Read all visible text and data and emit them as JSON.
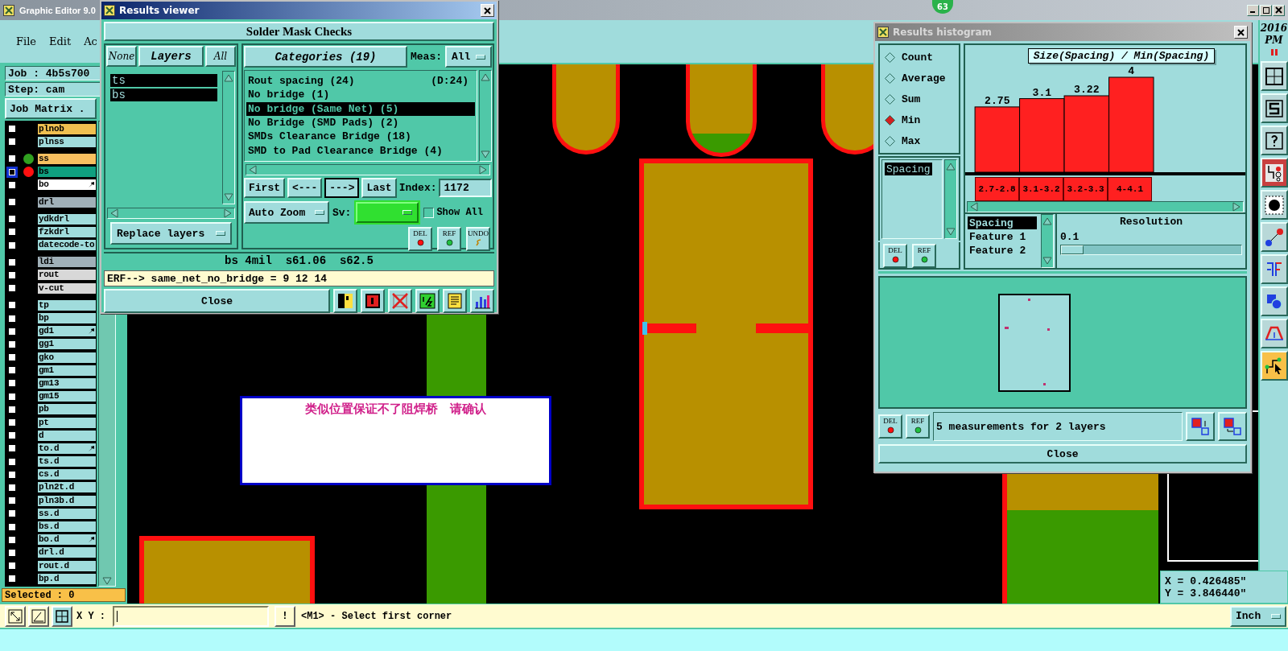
{
  "main_window": {
    "title": "Graphic Editor 9.0",
    "badge": "63"
  },
  "menu": [
    {
      "label": "File"
    },
    {
      "label": "Edit"
    },
    {
      "label": "Ac"
    }
  ],
  "job": "Job : 4b5s700",
  "step": "Step: cam",
  "job_matrix_button": "Job Matrix .",
  "layer_groups": [
    {
      "layers": [
        {
          "name": "plnob",
          "color": "#f0c050",
          "active": false,
          "flag": false
        },
        {
          "name": "plnss",
          "color": "#a0dcdc",
          "active": false,
          "flag": false
        }
      ]
    },
    {
      "layers": [
        {
          "name": "ss",
          "color": "#f8c060",
          "status": {
            "color": "#30a020"
          },
          "active": false,
          "flag": false
        },
        {
          "name": "bs",
          "color": "#10a080",
          "status": {
            "color": "#ff1010"
          },
          "active": true,
          "flag": false
        },
        {
          "name": "bo",
          "color": "#ffffff",
          "active": false,
          "flag": true
        }
      ]
    },
    {
      "layers": [
        {
          "name": "drl",
          "color": "#a0b0b8",
          "active": false,
          "flag": false
        }
      ]
    },
    {
      "layers": [
        {
          "name": "ydkdrl",
          "color": "#a0dcdc",
          "active": false,
          "flag": false
        },
        {
          "name": "fzkdrl",
          "color": "#a0dcdc",
          "active": false,
          "flag": false
        },
        {
          "name": "datecode-to",
          "color": "#a0dcdc",
          "active": false,
          "flag": false
        }
      ]
    },
    {
      "layers": [
        {
          "name": "ldi",
          "color": "#a0b0b8",
          "active": false,
          "flag": false
        },
        {
          "name": "rout",
          "color": "#d8d8d8",
          "active": false,
          "flag": false
        },
        {
          "name": "v-cut",
          "color": "#d8d8d8",
          "active": false,
          "flag": false
        }
      ]
    },
    {
      "layers": [
        {
          "name": "tp",
          "color": "#a0dcdc",
          "active": false,
          "flag": false
        },
        {
          "name": "bp",
          "color": "#a0dcdc",
          "active": false,
          "flag": false
        },
        {
          "name": "gd1",
          "color": "#a0dcdc",
          "active": false,
          "flag": true
        },
        {
          "name": "gg1",
          "color": "#a0dcdc",
          "active": false,
          "flag": false
        },
        {
          "name": "gko",
          "color": "#a0dcdc",
          "active": false,
          "flag": false
        },
        {
          "name": "gm1",
          "color": "#a0dcdc",
          "active": false,
          "flag": false
        },
        {
          "name": "gm13",
          "color": "#a0dcdc",
          "active": false,
          "flag": false
        },
        {
          "name": "gm15",
          "color": "#a0dcdc",
          "active": false,
          "flag": false
        },
        {
          "name": "pb",
          "color": "#a0dcdc",
          "active": false,
          "flag": false
        },
        {
          "name": "pt",
          "color": "#a0dcdc",
          "active": false,
          "flag": false
        },
        {
          "name": "d",
          "color": "#a0dcdc",
          "active": false,
          "flag": false
        },
        {
          "name": "to.d",
          "color": "#a0dcdc",
          "active": false,
          "flag": true
        },
        {
          "name": "ts.d",
          "color": "#a0dcdc",
          "active": false,
          "flag": false
        },
        {
          "name": "cs.d",
          "color": "#a0dcdc",
          "active": false,
          "flag": false
        },
        {
          "name": "pln2t.d",
          "color": "#a0dcdc",
          "active": false,
          "flag": false
        },
        {
          "name": "pln3b.d",
          "color": "#a0dcdc",
          "active": false,
          "flag": false
        },
        {
          "name": "ss.d",
          "color": "#a0dcdc",
          "active": false,
          "flag": false
        },
        {
          "name": "bs.d",
          "color": "#a0dcdc",
          "active": false,
          "flag": false
        },
        {
          "name": "bo.d",
          "color": "#a0dcdc",
          "active": false,
          "flag": true
        },
        {
          "name": "drl.d",
          "color": "#a0dcdc",
          "active": false,
          "flag": false
        },
        {
          "name": "rout.d",
          "color": "#a0dcdc",
          "active": false,
          "flag": false
        },
        {
          "name": "bp.d",
          "color": "#a0dcdc",
          "active": false,
          "flag": false
        }
      ]
    }
  ],
  "selected_count": "Selected : 0",
  "results_viewer": {
    "title": "Results viewer",
    "heading": "Solder Mask Checks",
    "layer_buttons": [
      {
        "label": "None",
        "kind": "plain"
      },
      {
        "label": "Layers",
        "kind": "title"
      },
      {
        "label": "All",
        "kind": "plain"
      }
    ],
    "layers": [
      {
        "name": "ts",
        "selected": true
      },
      {
        "name": "bs",
        "selected": true
      }
    ],
    "replace_dropdown": "Replace layers",
    "categories_button": "Categories (19)",
    "meas_label": "Meas:",
    "meas_value": "All",
    "categories": [
      {
        "label": "Rout spacing (24)",
        "note": "(D:24)",
        "selected": false
      },
      {
        "label": "No bridge (1)",
        "selected": false
      },
      {
        "label": "No bridge (Same Net) (5)",
        "selected": true
      },
      {
        "label": "No Bridge (SMD Pads) (2)",
        "selected": false
      },
      {
        "label": "SMDs Clearance Bridge (18)",
        "selected": false
      },
      {
        "label": "SMD to Pad Clearance Bridge (4)",
        "selected": false
      }
    ],
    "nav": [
      {
        "label": "First",
        "pressed": false
      },
      {
        "label": "<---",
        "pressed": false
      },
      {
        "label": "--->",
        "pressed": true
      },
      {
        "label": "Last",
        "pressed": false
      }
    ],
    "index_label": "Index:",
    "index_value": "1172",
    "zoom_dropdown": "Auto Zoom",
    "sv_label": "Sv:",
    "show_all": {
      "label": "Show All",
      "checked": false
    },
    "action_buttons": [
      "DEL",
      "REF",
      "UNDO"
    ],
    "status": "bs 4mil  s61.06  s62.5",
    "erf": "ERF--> same_net_no_bridge = 9 12 14",
    "close": "Close"
  },
  "histogram": {
    "title": "Results histogram",
    "modes": [
      {
        "label": "Count",
        "selected": false
      },
      {
        "label": "Average",
        "selected": false
      },
      {
        "label": "Sum",
        "selected": false
      },
      {
        "label": "Min",
        "selected": true
      },
      {
        "label": "Max",
        "selected": false
      }
    ],
    "fields": [
      {
        "label": "Spacing",
        "selected": true
      }
    ],
    "list_buttons": [
      "DEL",
      "REF"
    ],
    "chart_data": {
      "type": "bar",
      "title": "Size(Spacing) / Min(Spacing)",
      "categories": [
        "2.7-2.8",
        "3.1-3.2",
        "3.2-3.3",
        "4-4.1"
      ],
      "values": [
        2.75,
        3.1,
        3.22,
        4
      ],
      "data_labels": true
    },
    "value_labels": [
      "2.75",
      "3.1",
      "3.22",
      "4"
    ],
    "columns": [
      {
        "label": "Spacing",
        "selected": true
      },
      {
        "label": "Feature 1",
        "selected": false
      },
      {
        "label": "Feature 2",
        "selected": false
      }
    ],
    "resolution": {
      "label": "Resolution",
      "value": "0.1",
      "level": 0
    },
    "footer_buttons": [
      "DEL",
      "REF"
    ],
    "summary": "5 measurements for 2 layers",
    "close": "Close"
  },
  "clock": {
    "year": "2016",
    "period": "PM"
  },
  "tools": [
    {
      "selected": false,
      "alert": false
    },
    {
      "selected": false,
      "alert": false
    },
    {
      "selected": false,
      "alert": false
    },
    {
      "selected": false,
      "alert": true
    },
    {
      "selected": false,
      "alert": false
    },
    {
      "selected": false,
      "alert": false
    },
    {
      "selected": false,
      "alert": false
    },
    {
      "selected": false,
      "alert": false
    },
    {
      "selected": false,
      "alert": false
    },
    {
      "selected": true,
      "alert": false
    }
  ],
  "coords": [
    "X = 0.426485\"",
    "Y = 3.846440\""
  ],
  "message": "类似位置保证不了阻焊桥   请确认",
  "bottom_bar": {
    "xy_label": "X Y :",
    "warn_button": "!",
    "prompt": "<M1> - Select first corner",
    "units": "Inch"
  }
}
